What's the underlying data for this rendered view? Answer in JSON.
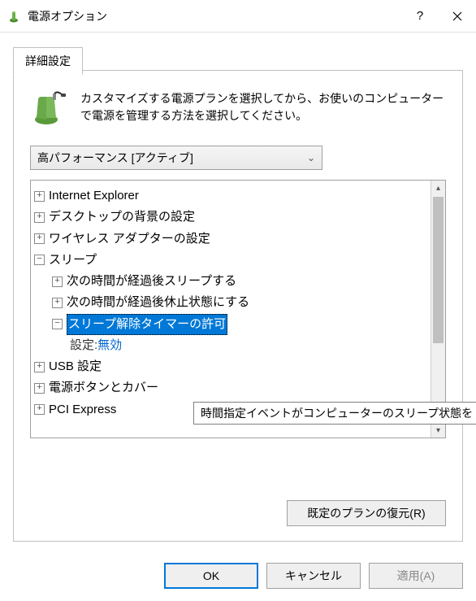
{
  "window": {
    "title": "電源オプション"
  },
  "tab": {
    "label": "詳細設定"
  },
  "description": "カスタマイズする電源プランを選択してから、お使いのコンピューターで電源を管理する方法を選択してください。",
  "plan_selector": {
    "value": "高パフォーマンス [アクティブ]"
  },
  "tree": {
    "items": [
      {
        "label": "Internet Explorer",
        "state": "collapsed",
        "depth": 0
      },
      {
        "label": "デスクトップの背景の設定",
        "state": "collapsed",
        "depth": 0
      },
      {
        "label": "ワイヤレス アダプターの設定",
        "state": "collapsed",
        "depth": 0
      },
      {
        "label": "スリープ",
        "state": "expanded",
        "depth": 0
      },
      {
        "label": "次の時間が経過後スリープする",
        "state": "collapsed",
        "depth": 1
      },
      {
        "label": "次の時間が経過後休止状態にする",
        "state": "collapsed",
        "depth": 1
      },
      {
        "label": "スリープ解除タイマーの許可",
        "state": "expanded",
        "depth": 1,
        "selected": true
      },
      {
        "label_prefix": "設定: ",
        "value": "無効",
        "depth": 2,
        "is_setting": true
      },
      {
        "label": "USB 設定",
        "state": "collapsed",
        "depth": 0
      },
      {
        "label": "電源ボタンとカバー",
        "state": "collapsed",
        "depth": 0
      },
      {
        "label": "PCI Express",
        "state": "collapsed",
        "depth": 0
      }
    ]
  },
  "tooltip": "時間指定イベントがコンピューターのスリープ状態を",
  "buttons": {
    "restore": "既定のプランの復元(R)",
    "ok": "OK",
    "cancel": "キャンセル",
    "apply": "適用(A)"
  }
}
